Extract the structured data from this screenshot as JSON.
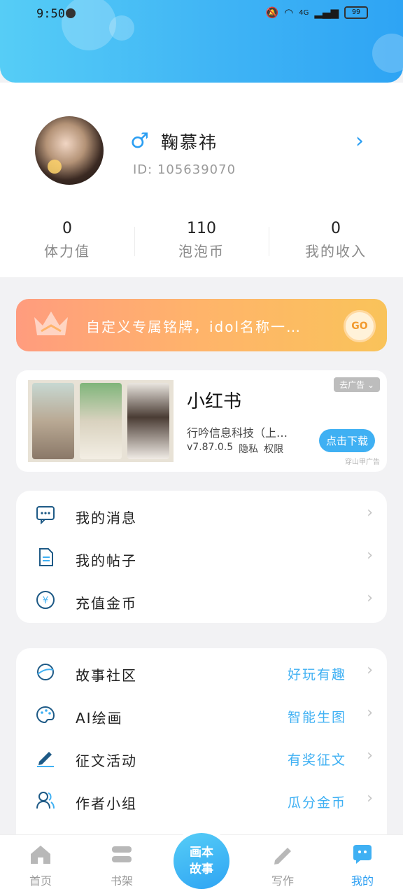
{
  "status_bar": {
    "time": "9:50",
    "network": "4G",
    "battery": "99"
  },
  "profile": {
    "name": "鞠慕祎",
    "id_label": "ID: 105639070",
    "gender_symbol": "♂"
  },
  "stats": [
    {
      "value": "0",
      "label": "体力值"
    },
    {
      "value": "110",
      "label": "泡泡币"
    },
    {
      "value": "0",
      "label": "我的收入"
    }
  ],
  "banner": {
    "text": "自定义专属铭牌，idol名称一…",
    "button": "GO"
  },
  "ad": {
    "close_label": "去广告",
    "title": "小红书",
    "company": "行吟信息科技（上…",
    "version": "v7.87.0.5",
    "privacy": "隐私",
    "permissions": "权限",
    "download": "点击下载",
    "source": "穿山甲广告"
  },
  "menu_primary": [
    {
      "label": "我的消息",
      "icon": "message-icon"
    },
    {
      "label": "我的帖子",
      "icon": "document-icon"
    },
    {
      "label": "充值金币",
      "icon": "coin-icon"
    }
  ],
  "menu_secondary": [
    {
      "label": "故事社区",
      "hint": "好玩有趣",
      "icon": "planet-icon"
    },
    {
      "label": "AI绘画",
      "hint": "智能生图",
      "icon": "palette-icon"
    },
    {
      "label": "征文活动",
      "hint": "有奖征文",
      "icon": "pen-icon"
    },
    {
      "label": "作者小组",
      "hint": "瓜分金币",
      "icon": "group-icon"
    }
  ],
  "tabs": [
    {
      "label": "首页",
      "icon": "home-icon"
    },
    {
      "label": "书架",
      "icon": "bookshelf-icon"
    },
    {
      "label": "画本\n故事",
      "icon": "create-story"
    },
    {
      "label": "写作",
      "icon": "write-icon"
    },
    {
      "label": "我的",
      "icon": "profile-chat-icon",
      "active": true
    }
  ],
  "colors": {
    "accent": "#2b9ef2",
    "header_start": "#56cdf6",
    "header_end": "#2ea4f4",
    "banner_start": "#ff9c7e",
    "banner_end": "#f9c35a"
  }
}
